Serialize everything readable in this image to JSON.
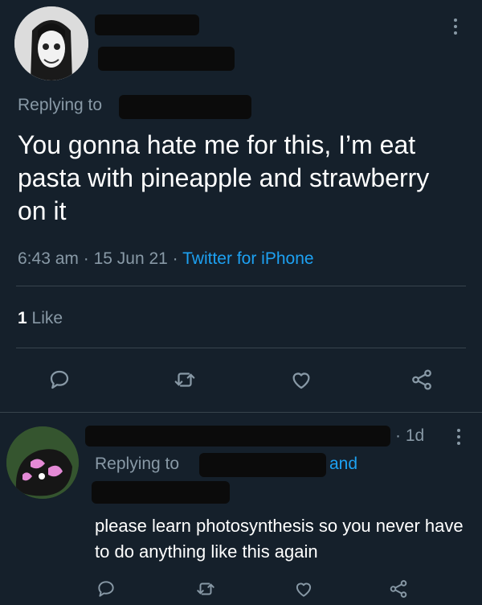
{
  "tweet": {
    "replying_label": "Replying to",
    "text": "You gonna hate me for this, I’m eat pasta with pineapple and strawberry on it",
    "time": "6:43 am",
    "sep1": "·",
    "date": "15 Jun 21",
    "sep2": "·",
    "source": "Twitter for iPhone",
    "likes_count": "1",
    "likes_label": "Like"
  },
  "reply": {
    "sep": "·",
    "age": "1d",
    "replying_label": "Replying to",
    "and_label": "and",
    "text": "please learn photosynthesis so you never have to do anything like this again"
  },
  "icons": {
    "reply": "comment-icon",
    "retweet": "retweet-icon",
    "like": "heart-icon",
    "share": "share-icon",
    "more": "more-dots-icon"
  },
  "colors": {
    "background": "#15202b",
    "text": "#ffffff",
    "muted": "#8899a6",
    "accent": "#1da1f2",
    "divider": "#38444d"
  }
}
